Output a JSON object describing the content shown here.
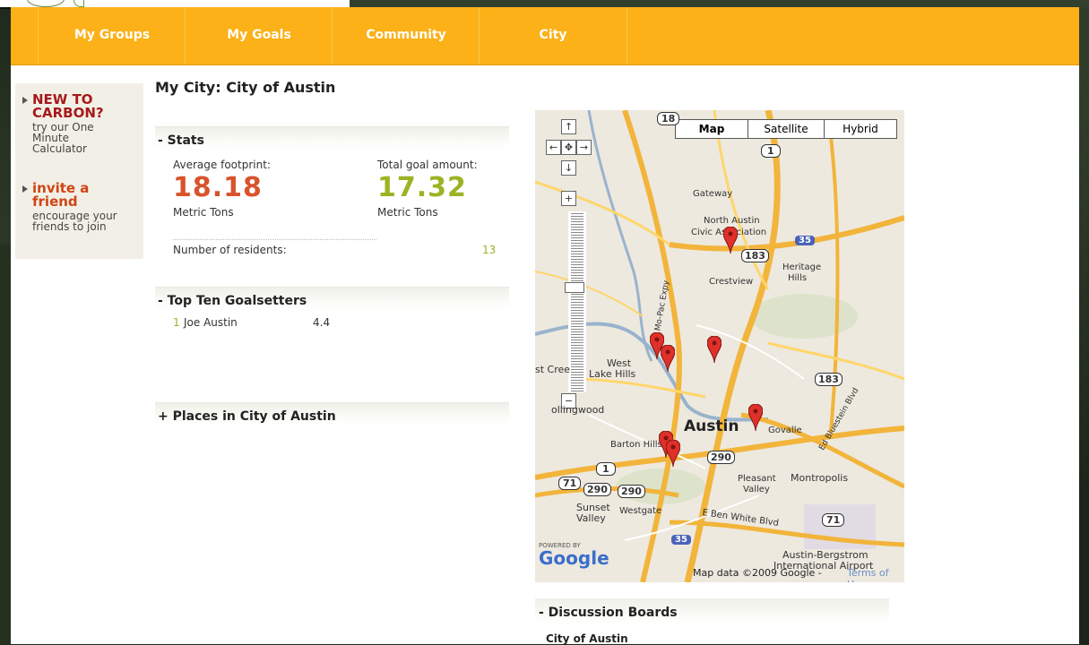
{
  "nav": {
    "items": [
      {
        "label": "My Groups"
      },
      {
        "label": "My Goals"
      },
      {
        "label": "Community"
      },
      {
        "label": "City"
      }
    ],
    "color": "#fbb117"
  },
  "sidebar": {
    "new_to_carbon": {
      "title": "NEW TO CARBON?",
      "sub": "try our One Minute Calculator"
    },
    "invite": {
      "title": "invite a friend",
      "sub": "encourage your friends to join"
    }
  },
  "page": {
    "title": "My City: City of Austin"
  },
  "stats": {
    "heading": "- Stats",
    "avg_label": "Average footprint:",
    "avg_value": "18.18",
    "avg_unit": "Metric Tons",
    "avg_color": "#d9532c",
    "goal_label": "Total goal amount:",
    "goal_value": "17.32",
    "goal_unit": "Metric Tons",
    "goal_color": "#9cb323",
    "residents_label": "Number of residents:",
    "residents_value": "13"
  },
  "goalsetters": {
    "heading": "- Top Ten Goalsetters",
    "rows": [
      {
        "rank": "1",
        "name": "Joe Austin",
        "value": "4.4"
      }
    ]
  },
  "places": {
    "heading": "+ Places in City of Austin"
  },
  "map": {
    "types": [
      "Map",
      "Satellite",
      "Hybrid"
    ],
    "active_type": "Map",
    "powered_by": "POWERED BY",
    "logo": "Google",
    "data_text": "Map data ©2009 Google -",
    "terms": "Terms of Use",
    "labels": {
      "gateway": "Gateway",
      "north_austin": "North Austin",
      "civic": "Civic Association",
      "heritage": "Heritage",
      "hills": "Hills",
      "crestview": "Crestview",
      "west": "West",
      "lake_hills": "Lake Hills",
      "crest": "st Cree",
      "rollingwood": "ollingwood",
      "austin": "Austin",
      "barton": "Barton Hills",
      "govalle": "Govalle",
      "pleasant": "Pleasant",
      "valley": "Valley",
      "montropolis": "Montropolis",
      "sunset": "Sunset",
      "sunset_valley": "Valley",
      "westgate": "Westgate",
      "ben_white": "E Ben White Blvd",
      "bergstrom": "Austin-Bergstrom",
      "airport": "International Airport",
      "mopac": "N Mo-Pac Expy",
      "bluestein": "Ed Bluestein Blvd"
    },
    "shields": {
      "s183a": "183",
      "s183b": "183",
      "s1a": "1",
      "s1b": "1",
      "s290a": "290",
      "s290b": "290",
      "s290c": "290",
      "s71a": "71",
      "s71b": "71",
      "s35a": "35",
      "s35b": "35",
      "s18": "18"
    },
    "pins": [
      {
        "name": "north-austin"
      },
      {
        "name": "west-1"
      },
      {
        "name": "west-2"
      },
      {
        "name": "central"
      },
      {
        "name": "govalle"
      },
      {
        "name": "barton-1"
      },
      {
        "name": "barton-2"
      }
    ]
  },
  "discussion": {
    "heading": "- Discussion Boards",
    "item": "City of Austin"
  }
}
